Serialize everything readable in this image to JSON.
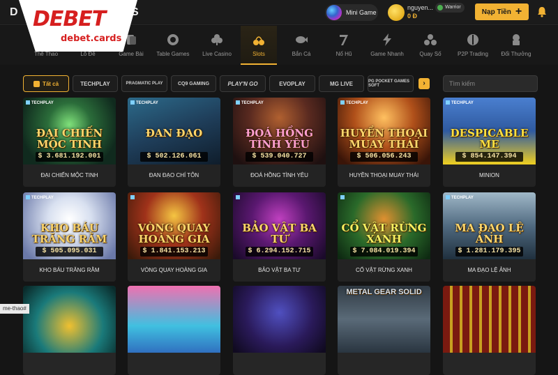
{
  "header": {
    "logo_main": "DEBET",
    "logo_sub": "debet.cards",
    "logo_peek_left": "D",
    "logo_peek_right": "S",
    "mini_game": "Mini Game",
    "username": "nguyen...",
    "balance": "0 Đ",
    "rank": "Warrior",
    "deposit": "Nạp Tiền"
  },
  "nav": [
    {
      "label": "Thể Thao",
      "icon": "soccer-ball-icon"
    },
    {
      "label": "Lô Đề",
      "icon": "lottery-ball-icon"
    },
    {
      "label": "Game Bài",
      "icon": "cards-icon"
    },
    {
      "label": "Table Games",
      "icon": "chip-icon"
    },
    {
      "label": "Live Casino",
      "icon": "clubs-icon"
    },
    {
      "label": "Slots",
      "icon": "cherry-icon"
    },
    {
      "label": "Bắn Cá",
      "icon": "fish-icon"
    },
    {
      "label": "Nổ Hũ",
      "icon": "seven-icon"
    },
    {
      "label": "Game Nhanh",
      "icon": "lightning-icon"
    },
    {
      "label": "Quay Số",
      "icon": "balls-icon"
    },
    {
      "label": "P2P Trading",
      "icon": "p2p-icon"
    },
    {
      "label": "Đổi Thưởng",
      "icon": "reward-icon"
    }
  ],
  "filters": {
    "all": "Tất cả",
    "providers": [
      "TECHPLAY",
      "PRAGMATIC PLAY",
      "CQ9 GAMING",
      "PLAY'N GO",
      "EVOPLAY",
      "MG LIVE",
      "PG POCKET GAMES SOFT"
    ],
    "search_placeholder": "Tìm kiếm"
  },
  "games": [
    {
      "name": "ĐẠI CHIẾN MỘC TINH",
      "jackpot": "$ 3.681.192.001",
      "art": "ĐẠI CHIẾN MỘC TINH",
      "provider": "TECHPLAY"
    },
    {
      "name": "ĐAN ĐẠO CHÍ TÔN",
      "jackpot": "$ 502.126.061",
      "art": "ĐAN ĐẠO",
      "provider": "TECHPLAY"
    },
    {
      "name": "ĐOÁ HỒNG TÌNH YÊU",
      "jackpot": "$ 539.040.727",
      "art": "ĐOÁ HỒNG TÌNH YÊU",
      "provider": "TECHPLAY"
    },
    {
      "name": "HUYỀN THOẠI MUAY THÁI",
      "jackpot": "$ 506.056.243",
      "art": "HUYỀN THOẠI MUAY THÁI",
      "provider": "TECHPLAY"
    },
    {
      "name": "MINION",
      "jackpot": "$ 854.147.394",
      "art": "DESPICABLE ME",
      "provider": "TECHPLAY"
    },
    {
      "name": "KHO BÁU TRĂNG RẰM",
      "jackpot": "$ 505.095.031",
      "art": "KHO BÁU TRĂNG RẰM",
      "provider": "TECHPLAY"
    },
    {
      "name": "VÒNG QUAY HOÀNG GIA",
      "jackpot": "$ 1.841.153.213",
      "art": "VÒNG QUAY HOÀNG GIA",
      "provider": ""
    },
    {
      "name": "BẢO VẬT BA TƯ",
      "jackpot": "$ 6.294.152.715",
      "art": "BẢO VẬT BA TƯ",
      "provider": ""
    },
    {
      "name": "CỔ VẬT RỪNG XANH",
      "jackpot": "$ 7.084.019.394",
      "art": "CỔ VẬT RỪNG XANH",
      "provider": ""
    },
    {
      "name": "MA ĐẠO LỆ ẢNH",
      "jackpot": "$ 1.281.179.395",
      "art": "MA ĐẠO LỆ ẢNH",
      "provider": "TECHPLAY"
    },
    {
      "name": "",
      "jackpot": "",
      "art": "",
      "provider": ""
    },
    {
      "name": "",
      "jackpot": "",
      "art": "",
      "provider": ""
    },
    {
      "name": "",
      "jackpot": "",
      "art": "",
      "provider": ""
    },
    {
      "name": "",
      "jackpot": "",
      "art": "METAL GEAR SOLID",
      "provider": ""
    },
    {
      "name": "",
      "jackpot": "",
      "art": "",
      "provider": ""
    }
  ],
  "status_url": "me-thao#",
  "colors": {
    "accent": "#f2b233",
    "background": "#151515",
    "card": "#262626"
  }
}
